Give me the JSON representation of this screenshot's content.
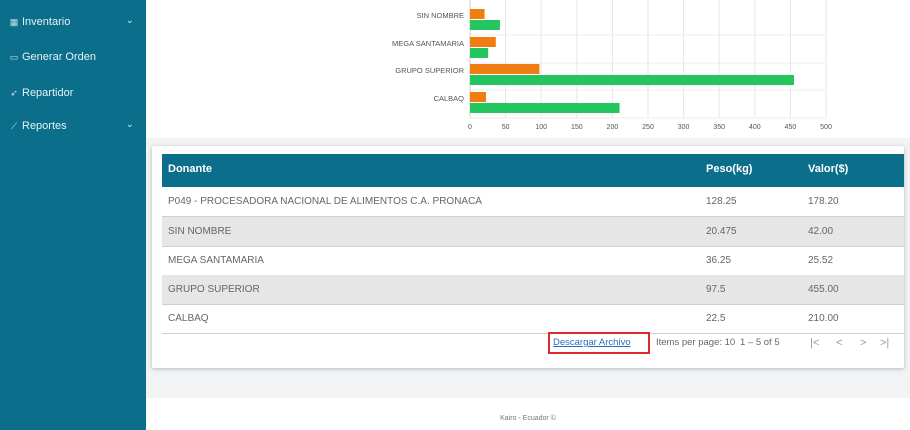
{
  "sidebar": {
    "items": [
      {
        "label": "Inventario",
        "icon": "box-icon",
        "has_chevron": true
      },
      {
        "label": "Generar Orden",
        "icon": "order-icon",
        "has_chevron": false
      },
      {
        "label": "Repartidor",
        "icon": "send-icon",
        "has_chevron": false
      },
      {
        "label": "Reportes",
        "icon": "chart-icon",
        "has_chevron": true
      }
    ]
  },
  "chart_data": {
    "type": "bar",
    "orientation": "horizontal",
    "categories": [
      "SIN NOMBRE",
      "MEGA SANTAMARIA",
      "GRUPO SUPERIOR",
      "CALBAQ"
    ],
    "series": [
      {
        "color": "#f07d12",
        "values": [
          20.475,
          36.25,
          97.5,
          22.5
        ]
      },
      {
        "color": "#22c55e",
        "values": [
          42,
          25.52,
          455,
          210
        ]
      }
    ],
    "xlim": [
      0,
      500
    ],
    "xticks": [
      "0",
      "50",
      "100",
      "150",
      "200",
      "250",
      "300",
      "350",
      "400",
      "450",
      "500"
    ],
    "grid": true
  },
  "table": {
    "headers": [
      "Donante",
      "Peso(kg)",
      "Valor($)"
    ],
    "rows": [
      [
        "P049 - PROCESADORA NACIONAL DE ALIMENTOS C.A. PRONACA",
        "128.25",
        "178.20"
      ],
      [
        "SIN NOMBRE",
        "20.475",
        "42.00"
      ],
      [
        "MEGA SANTAMARIA",
        "36.25",
        "25.52"
      ],
      [
        "GRUPO SUPERIOR",
        "97.5",
        "455.00"
      ],
      [
        "CALBAQ",
        "22.5",
        "210.00"
      ]
    ]
  },
  "pager": {
    "download_label": "Descargar Archivo",
    "items_per_page": "Items per page: 10",
    "range": "1 – 5 of 5",
    "first": "|<",
    "prev": "<",
    "next": ">",
    "last": ">|"
  },
  "footer": {
    "text": "Kairo - Ecuador ©"
  }
}
